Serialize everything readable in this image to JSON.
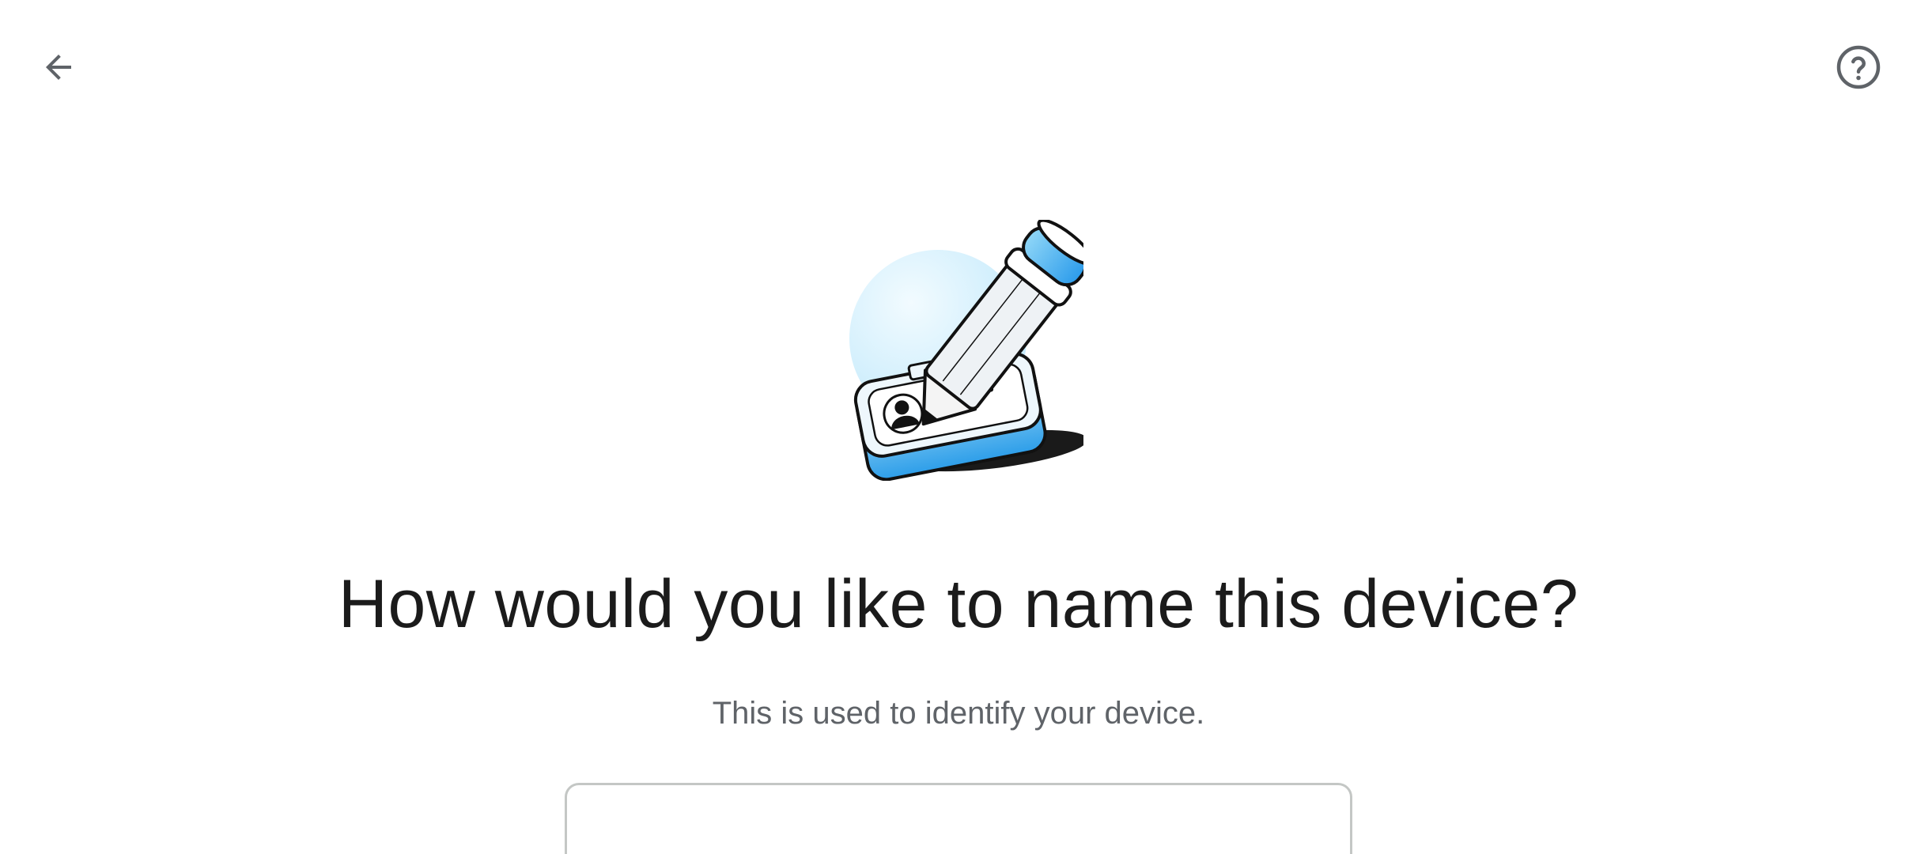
{
  "header": {
    "back_icon": "arrow-left-icon",
    "help_icon": "help-circle-icon"
  },
  "illustration": {
    "icon": "pencil-on-id-card-icon"
  },
  "content": {
    "title": "How would you like to name this device?",
    "subtitle": "This is used to identify your device."
  },
  "name_field": {
    "value": "",
    "placeholder": ""
  },
  "colors": {
    "background": "#ffffff",
    "title_text": "#1b1b1b",
    "subtitle_text": "#5f6368",
    "icon_gray": "#5f6368",
    "accent_blue": "#39a9ee",
    "accent_light_blue": "#cdeefc",
    "field_border": "#c4c7c5"
  }
}
